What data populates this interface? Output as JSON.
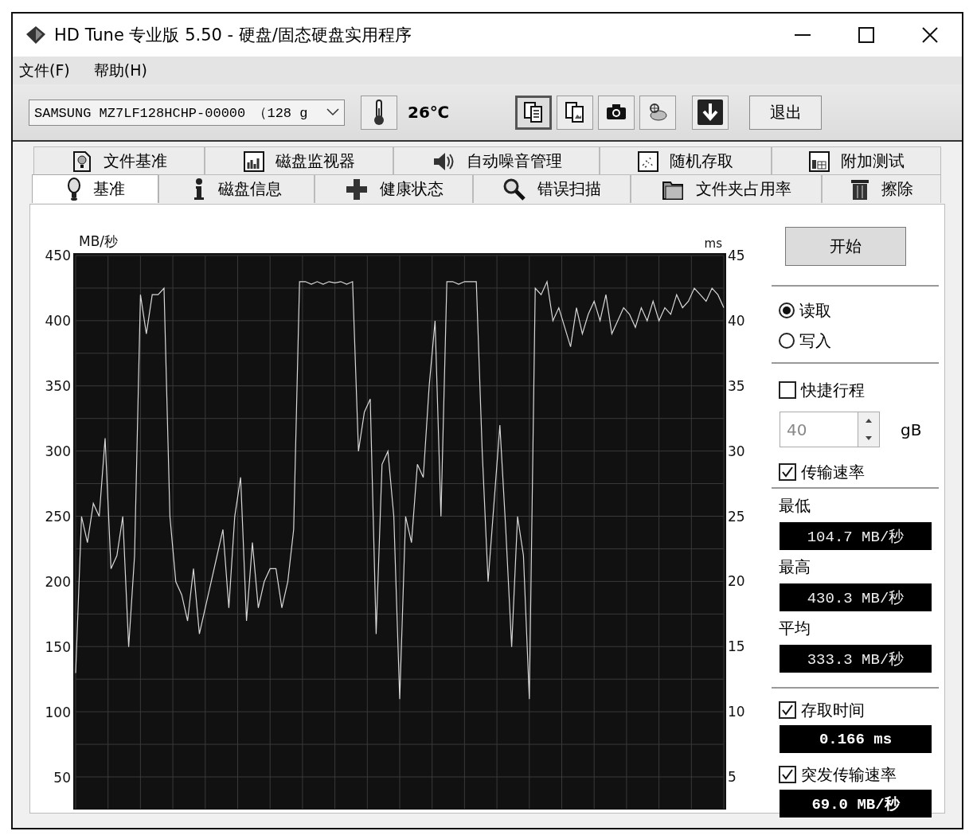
{
  "window": {
    "title": "HD Tune 专业版 5.50 - 硬盘/固态硬盘实用程序"
  },
  "menu": [
    {
      "label": "文件(F)"
    },
    {
      "label": "帮助(H)"
    }
  ],
  "toolbar": {
    "drive": "SAMSUNG MZ7LF128HCHP-00000 （128 g",
    "temperature": "26℃",
    "exit_button": "退出",
    "tool_buttons": [
      {
        "kind": "copy-text",
        "selected": true
      },
      {
        "kind": "copy-image",
        "selected": false
      },
      {
        "kind": "screenshot",
        "selected": false
      },
      {
        "kind": "options",
        "selected": false
      },
      {
        "kind": "save",
        "selected": false
      }
    ]
  },
  "tabs_top": [
    {
      "kind": "file-benchmark",
      "label": "文件基准",
      "selected": false
    },
    {
      "kind": "monitor",
      "label": "磁盘监视器",
      "selected": false
    },
    {
      "kind": "noise",
      "label": "自动噪音管理",
      "selected": false
    },
    {
      "kind": "random",
      "label": "随机存取",
      "selected": false
    },
    {
      "kind": "extra",
      "label": "附加测试",
      "selected": false
    }
  ],
  "tabs_bottom": [
    {
      "kind": "benchmark",
      "label": "基准",
      "selected": true
    },
    {
      "kind": "info",
      "label": "磁盘信息",
      "selected": false
    },
    {
      "kind": "health",
      "label": "健康状态",
      "selected": false
    },
    {
      "kind": "scan",
      "label": "错误扫描",
      "selected": false
    },
    {
      "kind": "folder",
      "label": "文件夹占用率",
      "selected": false
    },
    {
      "kind": "erase",
      "label": "擦除",
      "selected": false
    }
  ],
  "chart": {
    "left_unit": "MB/秒",
    "right_unit": "ms",
    "chart_data": {
      "type": "line",
      "grid": true,
      "ylim": [
        26,
        450
      ],
      "yticks": [
        450,
        400,
        350,
        300,
        250,
        200,
        150,
        100,
        50
      ],
      "series": [
        {
          "color": "#d8d8d8",
          "values": [
            130,
            250,
            230,
            260,
            250,
            310,
            210,
            220,
            250,
            150,
            220,
            420,
            390,
            420,
            420,
            425,
            250,
            200,
            190,
            170,
            210,
            160,
            180,
            200,
            220,
            240,
            180,
            250,
            280,
            170,
            230,
            180,
            200,
            210,
            210,
            180,
            200,
            240,
            430,
            430,
            428,
            430,
            428,
            430,
            429,
            430,
            428,
            430,
            300,
            330,
            340,
            160,
            290,
            300,
            250,
            110,
            250,
            230,
            290,
            280,
            350,
            400,
            250,
            430,
            430,
            428,
            430,
            430,
            430,
            300,
            200,
            260,
            320,
            240,
            150,
            250,
            220,
            110,
            425,
            420,
            430,
            400,
            410,
            395,
            380,
            410,
            390,
            405,
            415,
            400,
            420,
            390,
            400,
            410,
            405,
            395,
            410,
            400,
            415,
            400,
            410,
            405,
            420,
            410,
            415,
            425,
            420,
            415,
            425,
            420,
            410
          ]
        }
      ]
    },
    "right_ticks": [
      "45",
      "40",
      "35",
      "30",
      "25",
      "20",
      "15",
      "10",
      "5"
    ]
  },
  "side": {
    "start_button": "开始",
    "modes": [
      {
        "label": "读取",
        "selected": true
      },
      {
        "label": "写入",
        "selected": false
      }
    ],
    "short_stroke": {
      "label": "快捷行程",
      "checked": false
    },
    "stroke_value": "40",
    "stroke_unit": "gB",
    "transfer_rate": {
      "label": "传输速率",
      "checked": true
    },
    "readings": [
      {
        "label": "最低",
        "value": "104.7 MB/秒"
      },
      {
        "label": "最高",
        "value": "430.3 MB/秒"
      },
      {
        "label": "平均",
        "value": "333.3 MB/秒"
      }
    ],
    "access_time": {
      "label": "存取时间",
      "checked": true,
      "value": "0.166 ms"
    },
    "burst_rate": {
      "label": "突发传输速率",
      "checked": true,
      "value": "69.0 MB/秒"
    }
  }
}
